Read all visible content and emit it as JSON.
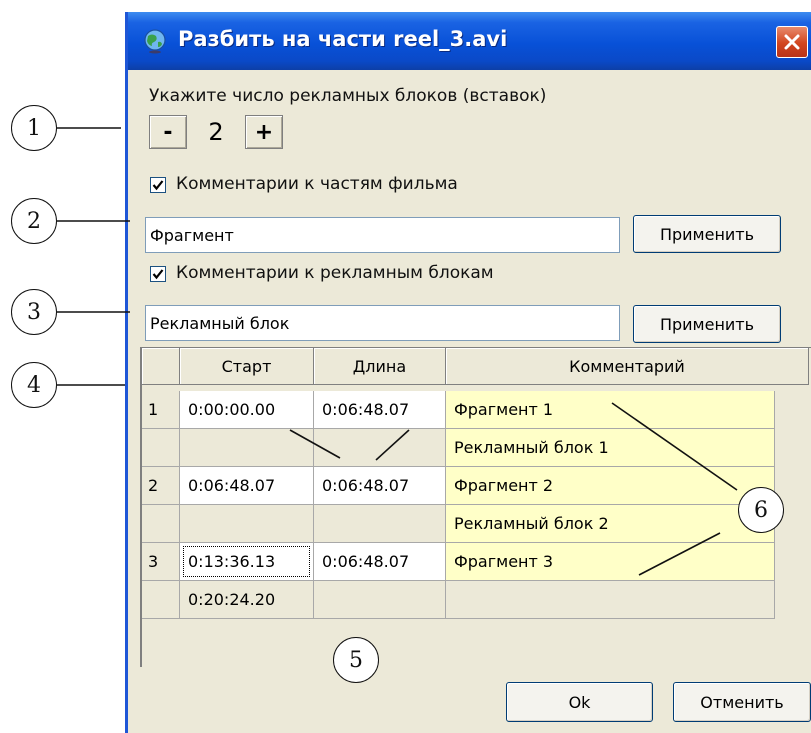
{
  "window": {
    "title": "Разбить на части reel_3.avi",
    "icons": {
      "app": "globe-icon",
      "close": "close-x-icon"
    },
    "colors": {
      "titlebar": "#0a52d8",
      "face": "#ece9d8",
      "close": "#d2451e",
      "comment_fill": "#ffffc8"
    }
  },
  "blocks": {
    "label": "Укажите число рекламных блоков (вставок)",
    "minus": "-",
    "value": "2",
    "plus": "+"
  },
  "parts_comment": {
    "checkbox_label": "Комментарии к частям фильма",
    "checked": true,
    "value": "Фрагмент",
    "apply": "Применить"
  },
  "ads_comment": {
    "checkbox_label": "Комментарии к рекламным блокам",
    "checked": true,
    "value": "Рекламный блок",
    "apply": "Применить"
  },
  "grid": {
    "headers": [
      "",
      "Старт",
      "Длина",
      "Комментарий"
    ],
    "rows": [
      {
        "index": "1",
        "start": "0:00:00.00",
        "length": "0:06:48.07",
        "comment": "Фрагмент 1"
      },
      {
        "index": "",
        "start": "",
        "length": "",
        "comment": "Рекламный блок 1"
      },
      {
        "index": "2",
        "start": "0:06:48.07",
        "length": "0:06:48.07",
        "comment": "Фрагмент 2"
      },
      {
        "index": "",
        "start": "",
        "length": "",
        "comment": "Рекламный блок 2"
      },
      {
        "index": "3",
        "start": "0:13:36.13",
        "length": "0:06:48.07",
        "comment": "Фрагмент 3"
      },
      {
        "index": "",
        "start": "0:20:24.20",
        "length": "",
        "comment": ""
      }
    ]
  },
  "footer": {
    "ok": "Ok",
    "cancel": "Отменить"
  },
  "callouts": [
    "1",
    "2",
    "3",
    "4",
    "5",
    "6"
  ]
}
